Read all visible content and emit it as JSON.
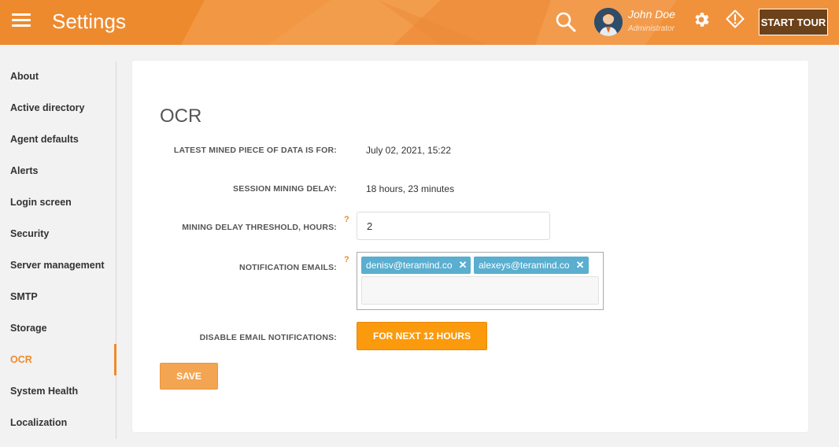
{
  "header": {
    "app_title": "Settings",
    "user_name": "John Doe",
    "user_role": "Administrator",
    "start_tour_label": "START TOUR",
    "accent_color": "#f08a2c"
  },
  "sidebar": {
    "items": [
      {
        "label": "About"
      },
      {
        "label": "Active directory"
      },
      {
        "label": "Agent defaults"
      },
      {
        "label": "Alerts"
      },
      {
        "label": "Login screen"
      },
      {
        "label": "Security"
      },
      {
        "label": "Server management"
      },
      {
        "label": "SMTP"
      },
      {
        "label": "Storage"
      },
      {
        "label": "OCR",
        "active": true
      },
      {
        "label": "System Health"
      },
      {
        "label": "Localization"
      }
    ]
  },
  "main": {
    "title": "OCR",
    "latest_label": "LATEST MINED PIECE OF DATA IS FOR:",
    "latest_value": "July 02, 2021, 15:22",
    "delay_label": "SESSION MINING DELAY:",
    "delay_value": "18 hours, 23 minutes",
    "threshold_label": "MINING DELAY THRESHOLD, HOURS:",
    "threshold_value": "2",
    "emails_label": "NOTIFICATION EMAILS:",
    "emails": [
      "denisv@teramind.co",
      "alexeys@teramind.co"
    ],
    "email_remove_glyph": "✕",
    "help_glyph": "?",
    "disable_label": "DISABLE EMAIL NOTIFICATIONS:",
    "disable_button": "FOR NEXT 12 HOURS",
    "save_button": "SAVE"
  }
}
